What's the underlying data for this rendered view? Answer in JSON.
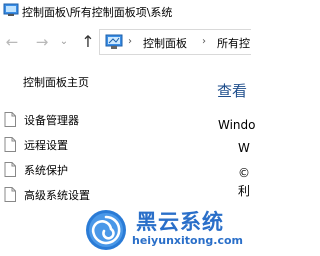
{
  "window": {
    "title": "控制面板\\所有控制面板项\\系统",
    "icon": "control-panel-icon"
  },
  "nav": {
    "back_icon": "arrow-left-icon",
    "forward_icon": "arrow-right-icon",
    "history_icon": "chevron-down-icon",
    "up_icon": "arrow-up-icon"
  },
  "address": {
    "icon": "control-panel-icon",
    "crumbs": [
      "控制面板",
      "所有控"
    ]
  },
  "sidebar": {
    "home": "控制面板主页",
    "items": [
      {
        "label": "设备管理器",
        "icon": "document-icon"
      },
      {
        "label": "远程设置",
        "icon": "document-icon"
      },
      {
        "label": "系统保护",
        "icon": "document-icon"
      },
      {
        "label": "高级系统设置",
        "icon": "document-icon"
      }
    ]
  },
  "main": {
    "heading": "查看",
    "edition_label": "Windo",
    "line_w": "W",
    "copyright": "©",
    "line_li": "利"
  },
  "watermark": {
    "title": "黑云系统",
    "url": "heiyunxitong.com",
    "icon": "swirl-logo-icon",
    "color": "#2a6fc9"
  }
}
